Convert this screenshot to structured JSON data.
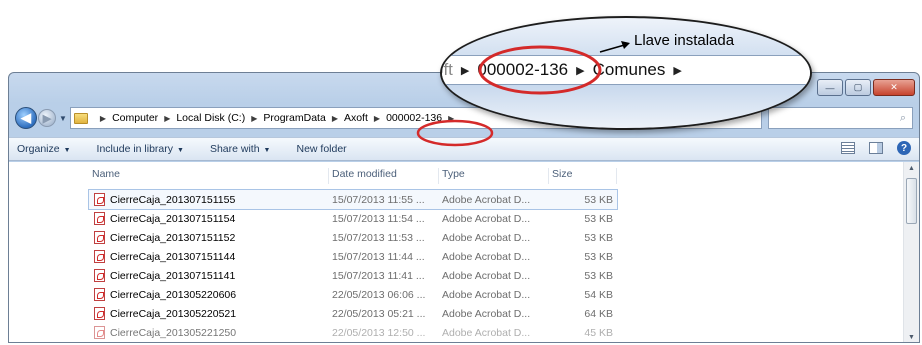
{
  "window": {
    "caption_buttons": [
      "—",
      "▢",
      "✕"
    ]
  },
  "address_bar": {
    "crumbs": [
      "Computer",
      "Local Disk (C:)",
      "ProgramData",
      "Axoft",
      "000002-136"
    ],
    "search_placeholder": ""
  },
  "toolbar": {
    "items": [
      "Organize",
      "Include in library",
      "Share with",
      "New folder"
    ]
  },
  "columns": {
    "name": "Name",
    "date": "Date modified",
    "type": "Type",
    "size": "Size"
  },
  "files": [
    {
      "name": "CierreCaja_201307151155",
      "date": "15/07/2013 11:55 ...",
      "type": "Adobe Acrobat D...",
      "size": "53 KB"
    },
    {
      "name": "CierreCaja_201307151154",
      "date": "15/07/2013 11:54 ...",
      "type": "Adobe Acrobat D...",
      "size": "53 KB"
    },
    {
      "name": "CierreCaja_201307151152",
      "date": "15/07/2013 11:53 ...",
      "type": "Adobe Acrobat D...",
      "size": "53 KB"
    },
    {
      "name": "CierreCaja_201307151144",
      "date": "15/07/2013 11:44 ...",
      "type": "Adobe Acrobat D...",
      "size": "53 KB"
    },
    {
      "name": "CierreCaja_201307151141",
      "date": "15/07/2013 11:41 ...",
      "type": "Adobe Acrobat D...",
      "size": "53 KB"
    },
    {
      "name": "CierreCaja_201305220606",
      "date": "22/05/2013 06:06 ...",
      "type": "Adobe Acrobat D...",
      "size": "54 KB"
    },
    {
      "name": "CierreCaja_201305220521",
      "date": "22/05/2013 05:21 ...",
      "type": "Adobe Acrobat D...",
      "size": "64 KB"
    },
    {
      "name": "CierreCaja_201305221250",
      "date": "22/05/2013 12:50 ...",
      "type": "Adobe Acrobat D...",
      "size": "45 KB"
    }
  ],
  "magnifier": {
    "crumb_prefix": "oft",
    "crumb_main": "000002-136",
    "crumb_next": "Comunes",
    "callout_label": "Llave instalada"
  },
  "colors": {
    "highlight_circle": "#d42a2a",
    "window_frame": "#b9cfe8"
  }
}
